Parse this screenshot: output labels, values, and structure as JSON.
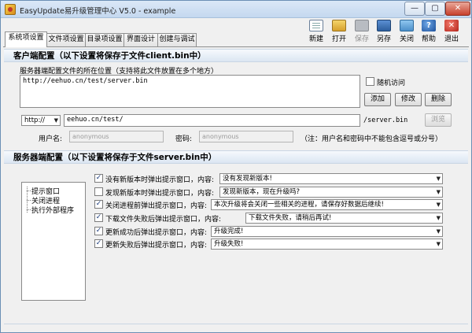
{
  "window": {
    "title": "EasyUpdate易升级管理中心 V5.0 - example",
    "min": "—",
    "max": "▢",
    "close": "✕"
  },
  "tabs": [
    "系统项设置",
    "文件项设置",
    "目录项设置",
    "界面设计",
    "创建与调试"
  ],
  "toolbar": {
    "new": "新建",
    "open": "打开",
    "save": "保存",
    "saveas": "另存",
    "close": "关闭",
    "help": "帮助",
    "exit": "退出",
    "help_glyph": "?",
    "exit_glyph": "✕"
  },
  "client": {
    "header": "客户端配置（以下设置将保存于文件client.bin中）",
    "location_label": "服务器端配置文件的所在位置（支持将此文件放置在多个地方）",
    "location_value": "http://eehuo.cn/test/server.bin",
    "random_access_label": "随机访问",
    "add_button": "添加",
    "modify_button": "修改",
    "delete_button": "删除",
    "protocol": "http://",
    "url_value": "eehuo.cn/test/",
    "url_suffix": "/server.bin",
    "browse_button": "浏览",
    "username_label": "用户名:",
    "username_value": "anonymous",
    "password_label": "密码:",
    "password_value": "anonymous",
    "note": "（注：用户名和密码中不能包含逗号或分号）"
  },
  "server": {
    "header": "服务器端配置（以下设置将保存于文件server.bin中）",
    "tree": [
      "提示窗口",
      "关闭进程",
      "执行外部程序"
    ],
    "rows": [
      {
        "label": "没有新版本时弹出提示窗口，内容:",
        "checked": true,
        "value": "没有发现新版本!"
      },
      {
        "label": "发现新版本时弹出提示窗口，内容:",
        "checked": false,
        "value": "发现新版本，现在升级吗?"
      },
      {
        "label": "关闭进程前弹出提示窗口，内容:",
        "checked": true,
        "value": "本次升级将会关闭一些相关的进程，请保存好数据后继续!"
      },
      {
        "label": "下载文件失败后弹出提示窗口，内容:",
        "checked": true,
        "value": "下载文件失败，请稍后再试!"
      },
      {
        "label": "更新成功后弹出提示窗口，内容:",
        "checked": true,
        "value": "升级完成!"
      },
      {
        "label": "更新失败后弹出提示窗口，内容:",
        "checked": true,
        "value": "升级失败!"
      }
    ],
    "check_glyph": "✓",
    "dropdown_glyph": "▼"
  },
  "colors": {
    "accent": "#1c4f9a",
    "section_bg": "#dbe6f2",
    "titlebar": "#c4d8ef"
  }
}
